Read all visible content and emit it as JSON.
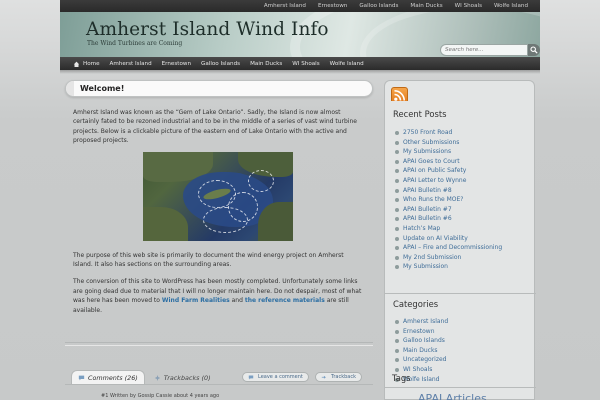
{
  "top_links": [
    "Amherst Island",
    "Ernestown",
    "Galloo Islands",
    "Main Ducks",
    "WI Shoals",
    "Wolfe Island"
  ],
  "site": {
    "title": "Amherst Island Wind Info",
    "tagline": "The Wind Turbines are Coming"
  },
  "search": {
    "placeholder": "Search here..."
  },
  "nav": {
    "home": "Home",
    "items": [
      "Amherst Island",
      "Ernestown",
      "Galloo Islands",
      "Main Ducks",
      "WI Shoals",
      "Wolfe Island"
    ]
  },
  "post": {
    "title": "Welcome!",
    "para1": "Amherst Island was known as the “Gem of Lake Ontario”.  Sadly, the Island is now almost certainly fated to be rezoned industrial and to be in the middle of a series of vast wind turbine projects.  Below is a clickable picture of the eastern end of Lake Ontario with the active and proposed projects.",
    "para2": "The purpose of this web site is primarily to document the wind energy project on Amherst Island.  It also has sections on the surrounding areas.",
    "para3_start": "The conversion of this site to WordPress has been mostly completed.  Unfortunately some links are going dead due to material that I will no longer maintain here.  Do not despair, most of what was here has been moved to ",
    "link1": "Wind Farm Realities",
    "para3_mid": " and ",
    "link2": "the reference materials",
    "para3_end": " are still available."
  },
  "comments": {
    "comments_tab": "Comments (26)",
    "trackbacks_tab": "Trackbacks (0)",
    "leave_comment": "Leave a comment",
    "trackback": "Trackback",
    "first_meta": "#1 Written by Gossip Cassie about 4 years ago"
  },
  "sidebar": {
    "recent_posts_title": "Recent Posts",
    "recent_posts": [
      "2750 Front Road",
      "Other Submissions",
      "My Submissions",
      "APAI Goes to Court",
      "APAI on Public Safety",
      "APAI Letter to Wynne",
      "APAI Bulletin #8",
      "Who Runs the MOE?",
      "APAI Bulletin #7",
      "APAI Bulletin #6",
      "Hatch’s Map",
      "Update on AI Viability",
      "APAI – Fire and Decommissioning",
      "My 2nd Submission",
      "My Submission"
    ],
    "categories_title": "Categories",
    "categories": [
      "Amherst Island",
      "Ernestown",
      "Galloo Islands",
      "Main Ducks",
      "Uncategorized",
      "WI Shoals",
      "Wolfe Island"
    ],
    "tags_title": "Tags",
    "tags_first": "APAI Articles"
  },
  "colors": {
    "link": "#3f6d98",
    "accent_rss": "#e1781c",
    "nav_bg": "#2b2b2b"
  }
}
